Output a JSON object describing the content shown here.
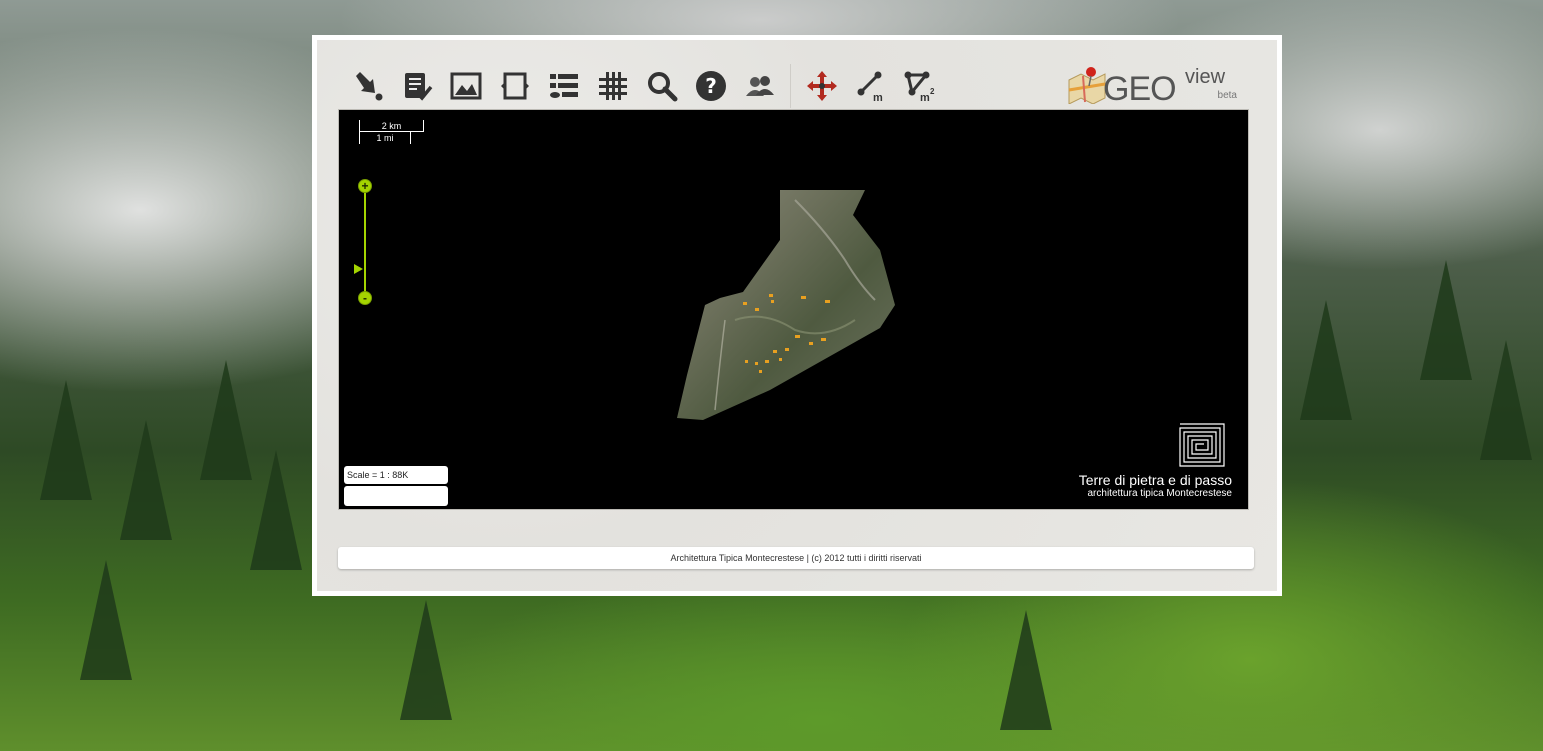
{
  "toolbar": {
    "tools": [
      {
        "icon": "select-arrow-icon"
      },
      {
        "icon": "checklist-icon"
      },
      {
        "icon": "image-icon"
      },
      {
        "icon": "expand-icon"
      },
      {
        "icon": "layers-list-icon"
      },
      {
        "icon": "grid-icon"
      },
      {
        "icon": "search-icon"
      },
      {
        "icon": "help-icon"
      },
      {
        "icon": "users-icon"
      },
      {
        "icon": "pan-icon"
      },
      {
        "icon": "measure-distance-icon",
        "label": "m"
      },
      {
        "icon": "measure-area-icon",
        "label": "m",
        "sup": "2"
      }
    ]
  },
  "logo": {
    "geo": "GEO",
    "view": "view",
    "beta": "beta"
  },
  "map": {
    "scalebar": {
      "top": "2 km",
      "bottom": "1 mi"
    },
    "zoom": {
      "plus": "+",
      "minus": "-",
      "level": 0.78
    },
    "scale_text": "Scale = 1 : 88K",
    "brand": {
      "title": "Terre di pietra e di passo",
      "subtitle": "architettura tipica Montecrestese"
    }
  },
  "footer": {
    "text": "Architettura Tipica Montecrestese | (c) 2012 tutti i diritti riservati"
  },
  "colors": {
    "accent": "#a4d400",
    "map_bg": "#000000",
    "marker": "#e8a020"
  }
}
